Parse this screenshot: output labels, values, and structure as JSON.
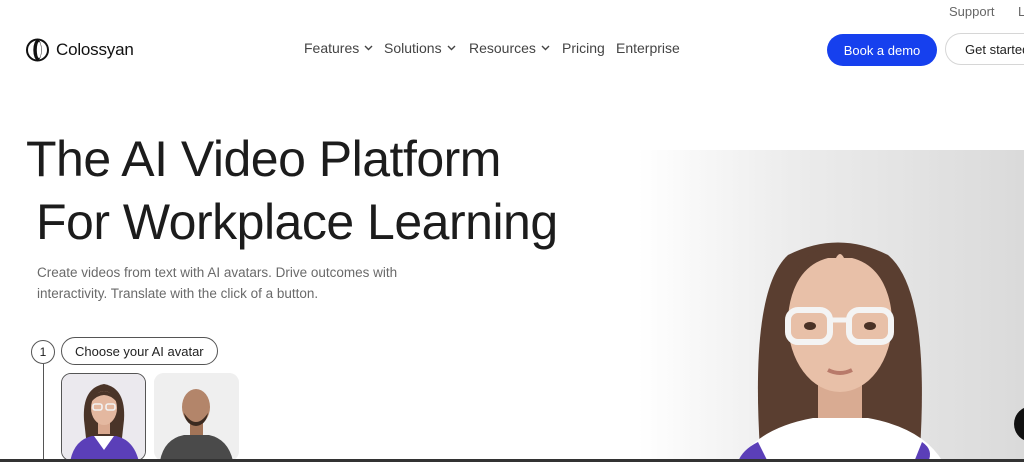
{
  "utility": {
    "support": "Support",
    "login": "L"
  },
  "brand": {
    "name": "Colossyan"
  },
  "nav": {
    "features": "Features",
    "solutions": "Solutions",
    "resources": "Resources",
    "pricing": "Pricing",
    "enterprise": "Enterprise"
  },
  "cta": {
    "book_demo": "Book a demo",
    "get_started": "Get started"
  },
  "hero": {
    "title_line1": "The AI Video Platform",
    "title_line2": "For Workplace Learning",
    "subtitle": "Create videos from text with AI avatars. Drive outcomes with interactivity. Translate with the click of a button."
  },
  "steps": [
    {
      "number": "1",
      "label": "Choose your AI avatar"
    }
  ],
  "colors": {
    "accent": "#1640ee",
    "avatar_shirt": "#5b3fb8"
  },
  "icons": {
    "chevron": "chevron-down-icon",
    "logo": "logo-icon"
  }
}
